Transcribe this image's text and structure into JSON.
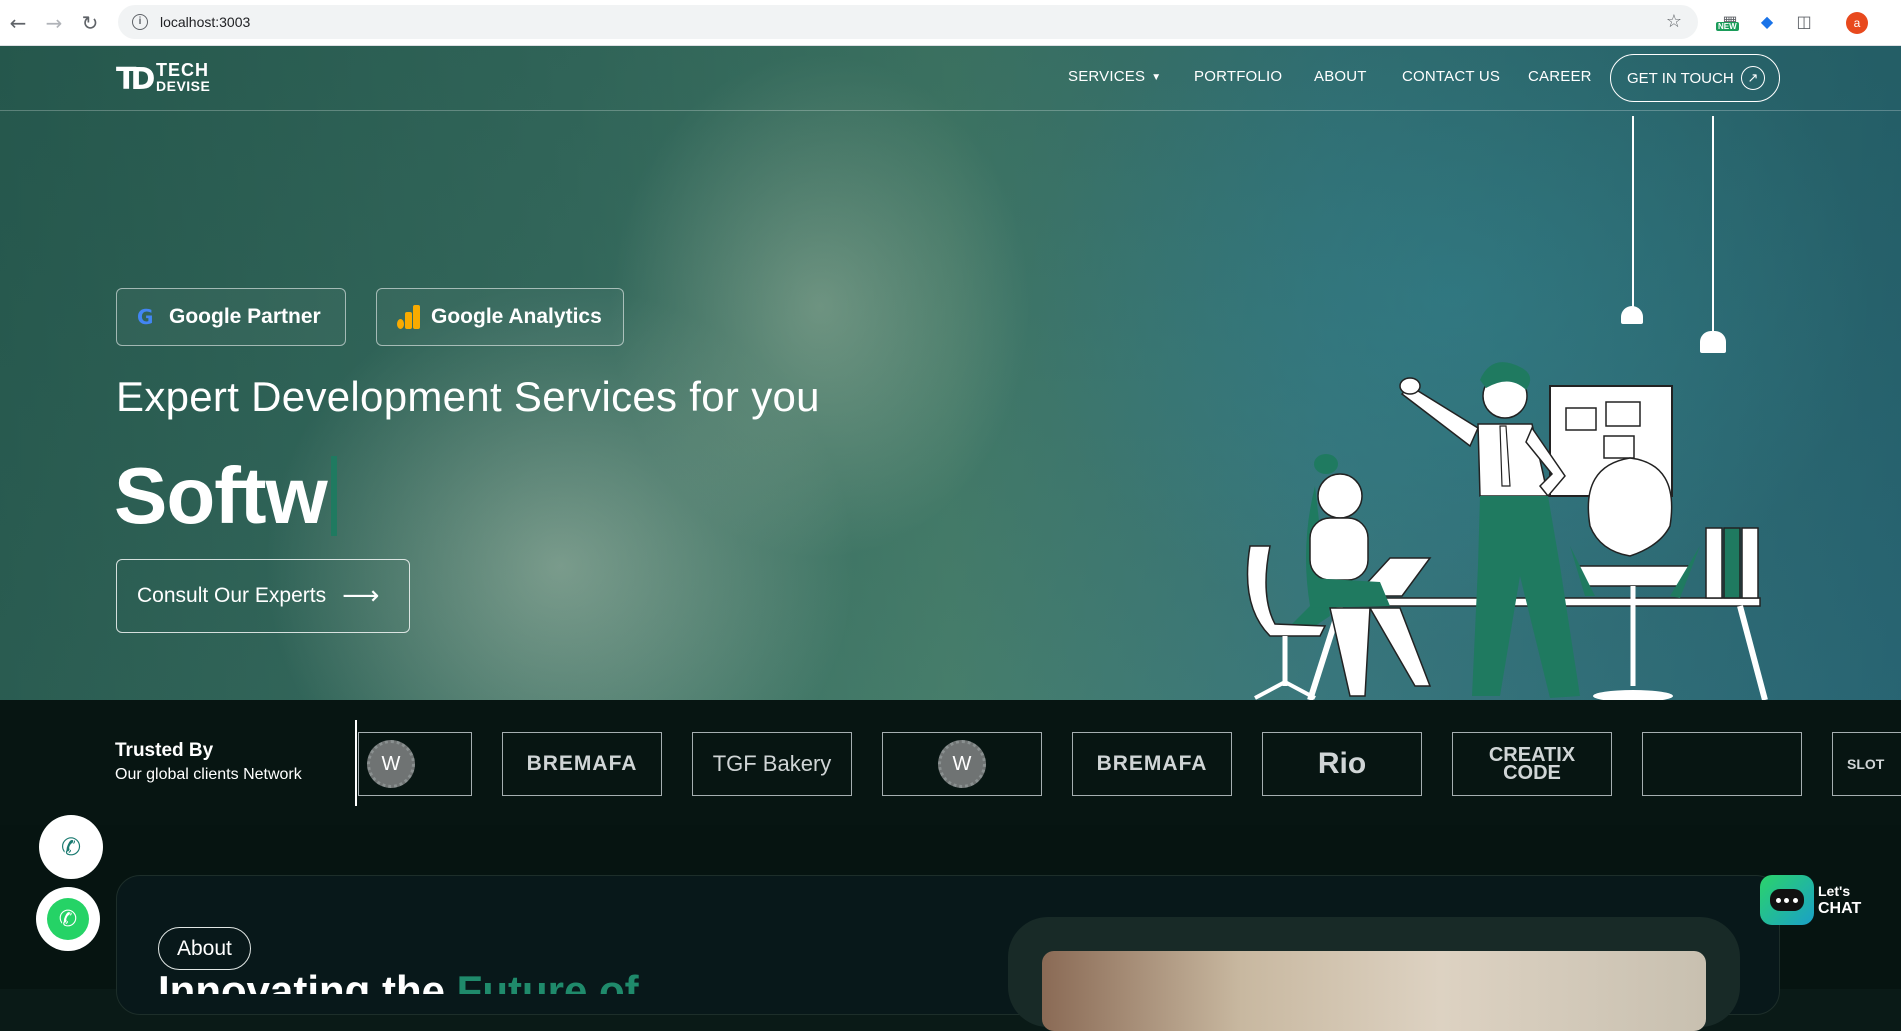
{
  "browser": {
    "url": "localhost:3003",
    "new_badge": "NEW",
    "profile_initial": "a"
  },
  "nav": {
    "logo_line1": "TECH",
    "logo_line2": "DEVISE",
    "items": [
      "SERVICES",
      "PORTFOLIO",
      "ABOUT",
      "CONTACT US",
      "CAREER"
    ],
    "cta": "GET IN TOUCH"
  },
  "hero": {
    "badges": [
      "Google Partner",
      "Google Analytics"
    ],
    "headline": "Expert Development Services for you",
    "typed_text": "Softw",
    "consult_button": "Consult Our Experts"
  },
  "trusted": {
    "title": "Trusted By",
    "subtitle": "Our global clients Network",
    "clients": [
      "W",
      "BREMAFA",
      "TGF Bakery",
      "W",
      "BREMAFA",
      "Rio",
      "CREATIX CODE",
      "",
      "SLOT"
    ]
  },
  "about": {
    "pill": "About",
    "heading_start": "Innovating the",
    "heading_accent": "Future of"
  },
  "chat": {
    "line1": "Let's",
    "line2": "CHAT"
  },
  "icons": {
    "back": "back-arrow-icon",
    "forward": "forward-arrow-icon",
    "reload": "reload-icon",
    "info": "info-icon",
    "star": "star-icon",
    "phone": "phone-icon",
    "whatsapp": "whatsapp-icon"
  },
  "colors": {
    "accent_green": "#1f7a60",
    "dark_bg": "#071512"
  }
}
